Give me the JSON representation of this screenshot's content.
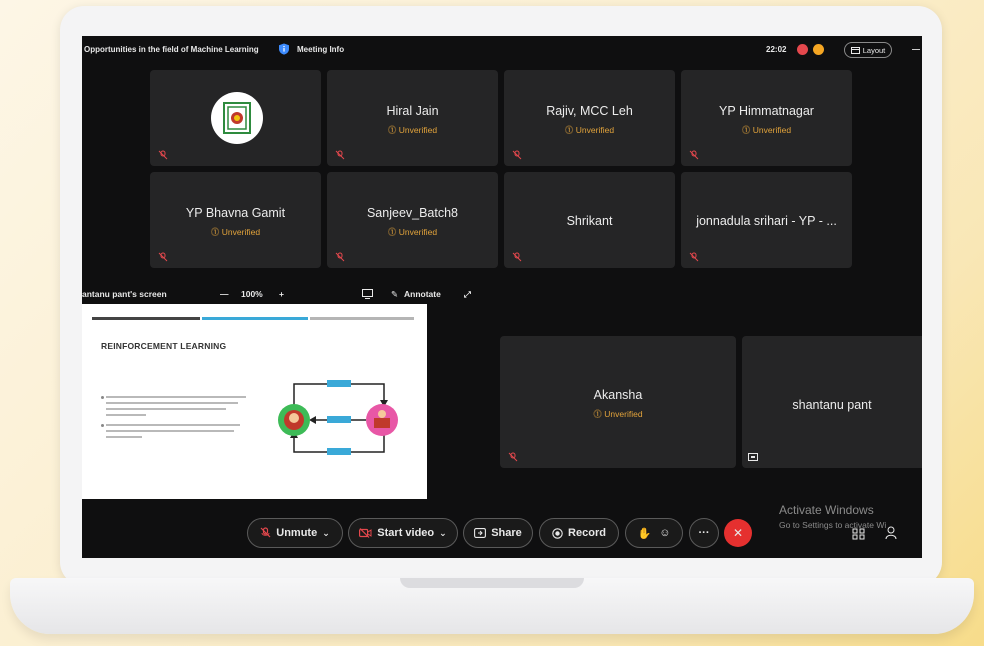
{
  "meeting": {
    "title": "Opportunities in the field of Machine Learning",
    "info_label": "Meeting Info",
    "time": "22:02",
    "layout_label": "Layout"
  },
  "participants_top": [
    {
      "name": "",
      "status": "",
      "is_logo": true
    },
    {
      "name": "Hiral Jain",
      "status": "Unverified"
    },
    {
      "name": "Rajiv, MCC Leh",
      "status": "Unverified"
    },
    {
      "name": "YP Himmatnagar",
      "status": "Unverified"
    },
    {
      "name": "YP Bhavna Gamit",
      "status": "Unverified"
    },
    {
      "name": "Sanjeev_Batch8",
      "status": "Unverified"
    },
    {
      "name": "Shrikant",
      "status": ""
    },
    {
      "name": "jonnadula srihari - YP - ...",
      "status": ""
    }
  ],
  "participants_bottom": [
    {
      "name": "Akansha",
      "status": "Unverified"
    },
    {
      "name": "shantanu pant",
      "status": ""
    }
  ],
  "screen_share": {
    "label": "antanu pant's screen",
    "zoom_minus": "—",
    "zoom": "100%",
    "zoom_plus": "+",
    "annotate_label": "Annotate",
    "slide_title": "REINFORCEMENT LEARNING"
  },
  "toolbar": {
    "unmute": "Unmute",
    "start_video": "Start video",
    "share": "Share",
    "record": "Record",
    "more": "···"
  },
  "watermark": {
    "title": "Activate Windows",
    "subtitle": "Go to Settings to activate Wi"
  },
  "colors": {
    "unverified": "#e2a33b",
    "end_call": "#e5302f",
    "tile_bg": "#252526"
  }
}
